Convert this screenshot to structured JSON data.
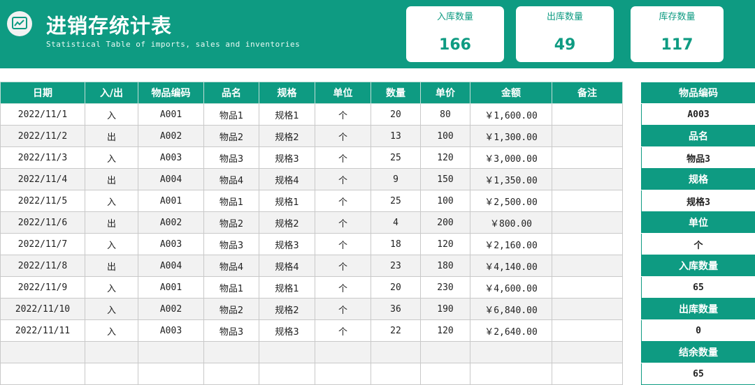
{
  "header": {
    "title": "进销存统计表",
    "subtitle": "Statistical Table of imports, sales and inventories",
    "icon": "chart-icon"
  },
  "stats": [
    {
      "label": "入库数量",
      "value": "166"
    },
    {
      "label": "出库数量",
      "value": "49"
    },
    {
      "label": "库存数量",
      "value": "117"
    }
  ],
  "table": {
    "columns": [
      "日期",
      "入/出",
      "物品编码",
      "品名",
      "规格",
      "单位",
      "数量",
      "单价",
      "金额",
      "备注"
    ],
    "rows": [
      [
        "2022/11/1",
        "入",
        "A001",
        "物品1",
        "规格1",
        "个",
        "20",
        "80",
        "￥1,600.00",
        ""
      ],
      [
        "2022/11/2",
        "出",
        "A002",
        "物品2",
        "规格2",
        "个",
        "13",
        "100",
        "￥1,300.00",
        ""
      ],
      [
        "2022/11/3",
        "入",
        "A003",
        "物品3",
        "规格3",
        "个",
        "25",
        "120",
        "￥3,000.00",
        ""
      ],
      [
        "2022/11/4",
        "出",
        "A004",
        "物品4",
        "规格4",
        "个",
        "9",
        "150",
        "￥1,350.00",
        ""
      ],
      [
        "2022/11/5",
        "入",
        "A001",
        "物品1",
        "规格1",
        "个",
        "25",
        "100",
        "￥2,500.00",
        ""
      ],
      [
        "2022/11/6",
        "出",
        "A002",
        "物品2",
        "规格2",
        "个",
        "4",
        "200",
        "￥800.00",
        ""
      ],
      [
        "2022/11/7",
        "入",
        "A003",
        "物品3",
        "规格3",
        "个",
        "18",
        "120",
        "￥2,160.00",
        ""
      ],
      [
        "2022/11/8",
        "出",
        "A004",
        "物品4",
        "规格4",
        "个",
        "23",
        "180",
        "￥4,140.00",
        ""
      ],
      [
        "2022/11/9",
        "入",
        "A001",
        "物品1",
        "规格1",
        "个",
        "20",
        "230",
        "￥4,600.00",
        ""
      ],
      [
        "2022/11/10",
        "入",
        "A002",
        "物品2",
        "规格2",
        "个",
        "36",
        "190",
        "￥6,840.00",
        ""
      ],
      [
        "2022/11/11",
        "入",
        "A003",
        "物品3",
        "规格3",
        "个",
        "22",
        "120",
        "￥2,640.00",
        ""
      ],
      [
        "",
        "",
        "",
        "",
        "",
        "",
        "",
        "",
        "",
        ""
      ],
      [
        "",
        "",
        "",
        "",
        "",
        "",
        "",
        "",
        "",
        ""
      ]
    ]
  },
  "side_panel": [
    {
      "label": "物品编码",
      "value": "A003"
    },
    {
      "label": "品名",
      "value": "物品3"
    },
    {
      "label": "规格",
      "value": "规格3"
    },
    {
      "label": "单位",
      "value": "个"
    },
    {
      "label": "入库数量",
      "value": "65"
    },
    {
      "label": "出库数量",
      "value": "0"
    },
    {
      "label": "结余数量",
      "value": "65"
    }
  ],
  "colors": {
    "accent": "#0e9b82",
    "alt_row": "#f2f2f2",
    "border": "#c9c9c9"
  }
}
